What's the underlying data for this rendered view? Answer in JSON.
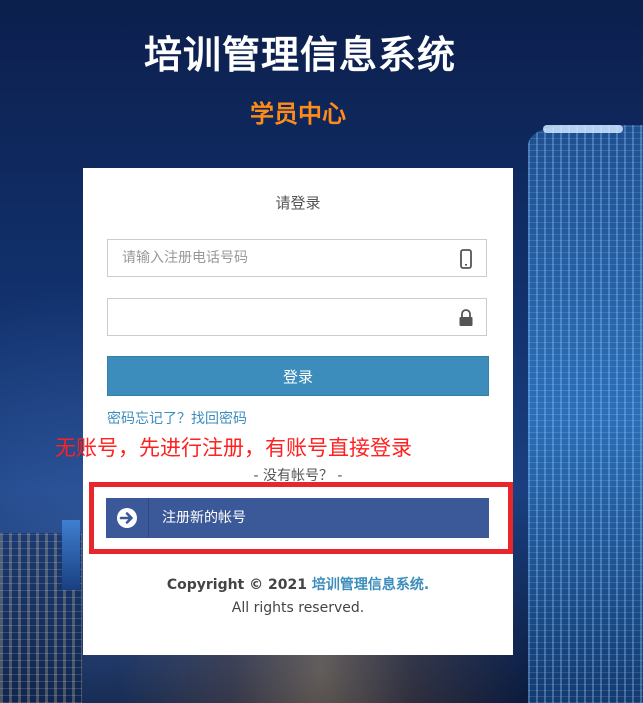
{
  "header": {
    "title": "培训管理信息系统",
    "subtitle": "学员中心"
  },
  "login": {
    "heading": "请登录",
    "phone_placeholder": "请输入注册电话号码",
    "password_placeholder": "",
    "phone_icon": "mobile-phone-icon",
    "password_icon": "lock-icon",
    "login_label": "登录",
    "forgot_link": "密码忘记了？找回密码"
  },
  "annotation": {
    "text": "无账号，先进行注册，有账号直接登录"
  },
  "register": {
    "no_account": "- 没有帐号？ -",
    "register_label": "注册新的帐号",
    "icon": "arrow-circle-right-icon"
  },
  "footer": {
    "copyright_prefix": "Copyright © 2021 ",
    "brand": "培训管理信息系统.",
    "rights": "All rights reserved."
  },
  "colors": {
    "title": "#ffffff",
    "subtitle": "#ff8c1a",
    "login_button": "#3c8dbc",
    "register_button": "#3b5998",
    "annotation": "#ff2020",
    "highlight_frame": "#e8262b",
    "link": "#3c8dbc"
  }
}
